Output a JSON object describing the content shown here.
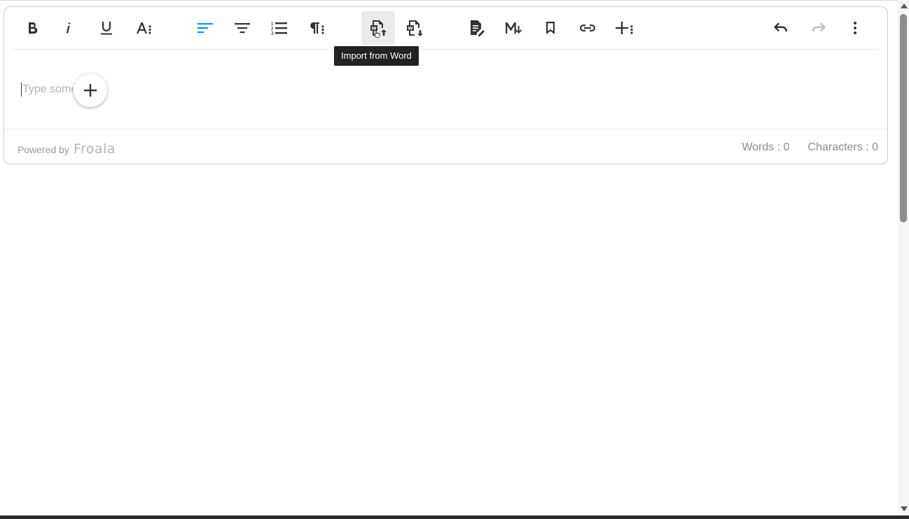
{
  "toolbar": {
    "buttons": [
      {
        "name": "bold-button",
        "icon": "bold-icon"
      },
      {
        "name": "italic-button",
        "icon": "italic-icon"
      },
      {
        "name": "underline-button",
        "icon": "underline-icon"
      },
      {
        "name": "more-text-button",
        "icon": "text-more-icon"
      },
      {
        "name": "align-left-button",
        "icon": "align-left-icon",
        "color": "#0098f7"
      },
      {
        "name": "align-center-button",
        "icon": "align-center-icon"
      },
      {
        "name": "ordered-list-button",
        "icon": "ordered-list-icon"
      },
      {
        "name": "more-paragraph-button",
        "icon": "paragraph-more-icon"
      },
      {
        "name": "import-word-button",
        "icon": "import-word-icon"
      },
      {
        "name": "export-word-button",
        "icon": "export-word-icon"
      },
      {
        "name": "document-edit-button",
        "icon": "document-edit-icon"
      },
      {
        "name": "markdown-button",
        "icon": "markdown-icon"
      },
      {
        "name": "bookmark-button",
        "icon": "bookmark-icon"
      },
      {
        "name": "link-button",
        "icon": "link-icon"
      },
      {
        "name": "more-rich-button",
        "icon": "plus-more-icon"
      },
      {
        "name": "undo-button",
        "icon": "undo-icon"
      },
      {
        "name": "redo-button",
        "icon": "redo-icon"
      },
      {
        "name": "more-options-button",
        "icon": "vertical-dots-icon"
      }
    ],
    "italic_glyph": "i",
    "tooltip": "Import from Word"
  },
  "editor": {
    "placeholder": "Type something"
  },
  "footer": {
    "powered_by": "Powered by",
    "brand": "Froala",
    "words": "Words : 0",
    "characters": "Characters : 0"
  },
  "colors": {
    "accent": "#0098f7",
    "icon": "#333333",
    "icon_disabled": "#bdbdbd"
  }
}
